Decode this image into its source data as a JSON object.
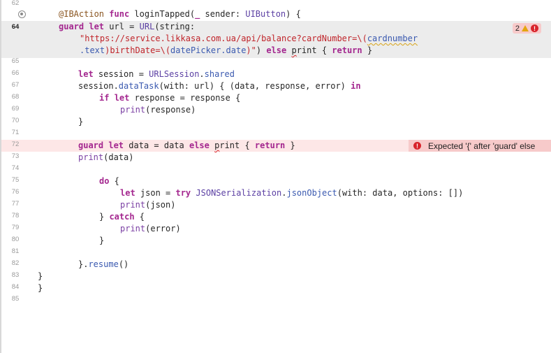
{
  "line_numbers": {
    "l62": "62",
    "l64": "64",
    "l65": "65",
    "l66": "66",
    "l67": "67",
    "l68": "68",
    "l69": "69",
    "l70": "70",
    "l71": "71",
    "l72": "72",
    "l73": "73",
    "l74": "74",
    "l75": "75",
    "l76": "76",
    "l77": "77",
    "l78": "78",
    "l79": "79",
    "l80": "80",
    "l81": "81",
    "l82": "82",
    "l83": "83",
    "l84": "84",
    "l85": "85"
  },
  "code": {
    "l63": {
      "t1": "@IBAction",
      "t2": " ",
      "t3": "func",
      "t4": " loginTapped(",
      "t5": "_",
      "t6": " sender: ",
      "t7": "UIButton",
      "t8": ") {"
    },
    "l64": {
      "t1": "guard",
      "t2": " ",
      "t3": "let",
      "t4": " url = ",
      "t5": "URL",
      "t6": "(string:"
    },
    "l64b": {
      "t1": "\"https://service.likkasa.com.ua/api/balance?cardNumber=\\(",
      "t2": "cardnumber"
    },
    "l64c": {
      "t1": ".text",
      "t2": ")birthDate=\\(",
      "t3": "datePicker",
      "t4": ".date",
      "t5": ")\"",
      "t6": ") ",
      "t7": "else",
      "t8": " ",
      "t9": "p",
      "t10": "rint { ",
      "t11": "return",
      "t12": " }"
    },
    "l66": {
      "t1": "let",
      "t2": " session = ",
      "t3": "URLSession",
      "t4": ".",
      "t5": "shared"
    },
    "l67": {
      "t1": "session.",
      "t2": "dataTask",
      "t3": "(with: url) { (data, response, error) ",
      "t4": "in"
    },
    "l68": {
      "t1": "if",
      "t2": " ",
      "t3": "let",
      "t4": " response = response {"
    },
    "l69": {
      "t1": "print",
      "t2": "(response)"
    },
    "l70": {
      "t1": "}"
    },
    "l72": {
      "t1": "guard",
      "t2": " ",
      "t3": "let",
      "t4": " data = data ",
      "t5": "else",
      "t6": " ",
      "t7": "p",
      "t8": "rint { ",
      "t9": "return",
      "t10": " }"
    },
    "l73": {
      "t1": "print",
      "t2": "(data)"
    },
    "l75": {
      "t1": "do",
      "t2": " {"
    },
    "l76": {
      "t1": "let",
      "t2": " json = ",
      "t3": "try",
      "t4": " ",
      "t5": "JSONSerialization",
      "t6": ".",
      "t7": "jsonObject",
      "t8": "(with: data, options: [])"
    },
    "l77": {
      "t1": "print",
      "t2": "(json)"
    },
    "l78": {
      "t1": "} ",
      "t2": "catch",
      "t3": " {"
    },
    "l79": {
      "t1": "print",
      "t2": "(error)"
    },
    "l80": {
      "t1": "}"
    },
    "l82": {
      "t1": "}.",
      "t2": "resume",
      "t3": "()"
    },
    "l83": {
      "t1": "}"
    },
    "l84": {
      "t1": "}"
    }
  },
  "issue_badge": {
    "count": "2",
    "warning_icon": "warning-triangle-icon",
    "error_icon": "error-circle-icon",
    "error_glyph": "!"
  },
  "error_message": {
    "text": "Expected '{' after 'guard' else",
    "icon": "error-circle-icon",
    "icon_glyph": "!"
  },
  "colors": {
    "error_line": "#fde7e7",
    "current_line": "#ececec",
    "keyword": "#a4278f",
    "string": "#c0242a",
    "error": "#d8242b",
    "warning": "#e4a50f"
  }
}
